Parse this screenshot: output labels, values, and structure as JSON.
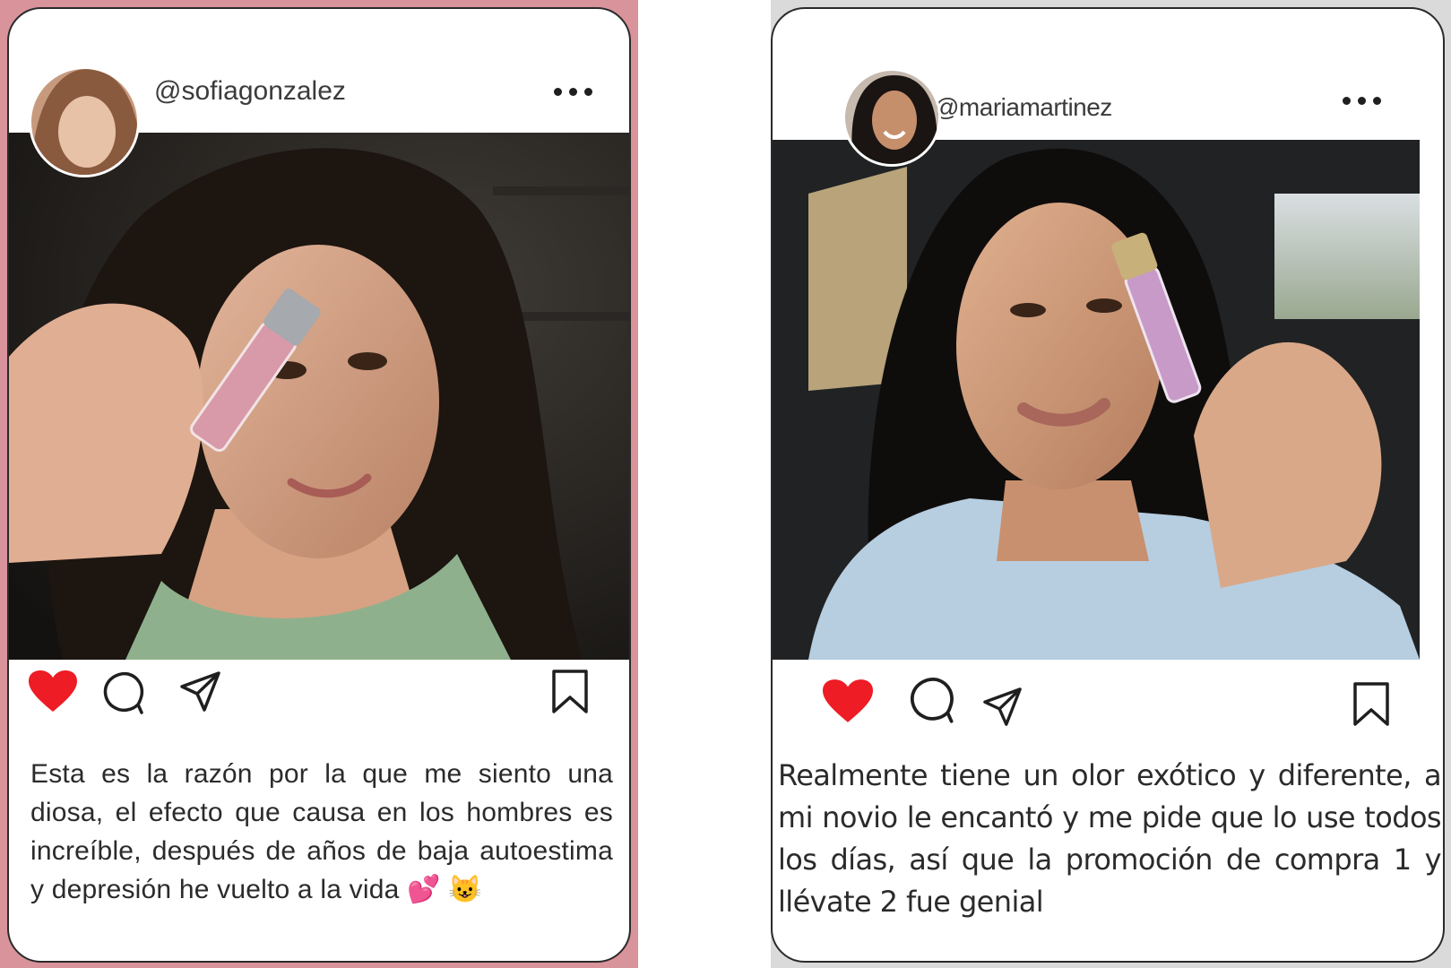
{
  "posts": [
    {
      "username": "@sofiagonzalez",
      "caption": "Esta es la razón por la que me siento una diosa, el efecto que causa en los hombres es increíble, después de años de baja autoestima y depresión he vuelto a la vida 💕 😺",
      "liked": true,
      "photo": "mujer de cabello rizado y blusa verde sosteniendo un frasco de perfume roll-on rosado junto a su frente",
      "avatar": "retrato de mujer con cabello castaño"
    },
    {
      "username": "@mariamartinez",
      "caption": "Realmente tiene un olor exótico y diferente, a mi novio le encantó y me pide que lo use todos los días, así que la promoción de compra 1 y llévate 2 fue genial",
      "liked": true,
      "photo": "mujer de cabello negro largo dentro de un auto sosteniendo un frasco de perfume rosado",
      "avatar": "retrato de mujer sonriente con cabello oscuro"
    }
  ],
  "colors": {
    "left_frame": "#d9939b",
    "like": "#ee1c25",
    "text": "#2b2b2b"
  },
  "icons": [
    "heart-icon",
    "comment-icon",
    "share-icon",
    "bookmark-icon",
    "more-icon"
  ]
}
